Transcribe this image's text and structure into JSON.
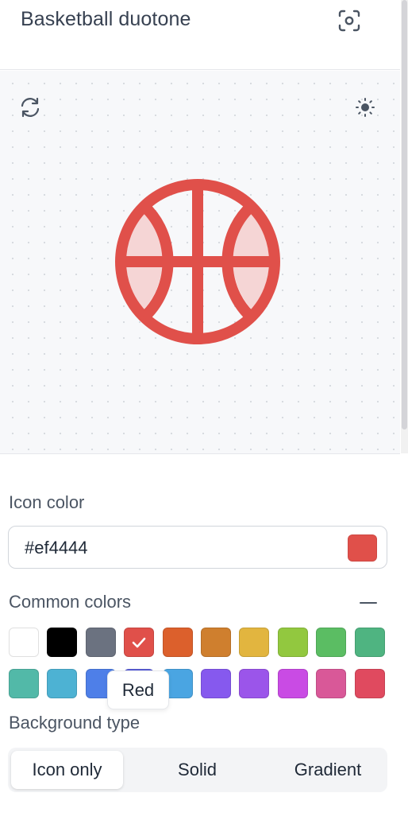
{
  "header": {
    "title": "Basketball duotone",
    "screenshot_icon": "focus-camera-icon"
  },
  "preview": {
    "refresh_icon": "refresh-icon",
    "theme_icon": "sun-icon",
    "icon_name": "basketball-duotone-icon",
    "icon_color": "#e0504a",
    "icon_fill_color": "#f5d5d5"
  },
  "icon_color": {
    "label": "Icon color",
    "value": "#ef4444",
    "swatch": "#e0504a"
  },
  "common_colors": {
    "label": "Common colors",
    "collapse_icon": "minus-icon",
    "selected": "Red",
    "tooltip": "Red",
    "colors": [
      {
        "name": "White",
        "hex": "#ffffff"
      },
      {
        "name": "Black",
        "hex": "#000000"
      },
      {
        "name": "Gray",
        "hex": "#6b7280"
      },
      {
        "name": "Red",
        "hex": "#e0504a"
      },
      {
        "name": "Orange",
        "hex": "#dc602c"
      },
      {
        "name": "Amber",
        "hex": "#cf7f2e"
      },
      {
        "name": "Yellow",
        "hex": "#e2b53f"
      },
      {
        "name": "Lime",
        "hex": "#92c83f"
      },
      {
        "name": "Green",
        "hex": "#5bbd63"
      },
      {
        "name": "Emerald",
        "hex": "#4fb481"
      },
      {
        "name": "Teal",
        "hex": "#52b9a8"
      },
      {
        "name": "Cyan",
        "hex": "#4db2d3"
      },
      {
        "name": "Blue",
        "hex": "#4e7fe8"
      },
      {
        "name": "Indigo",
        "hex": "#5f63e0"
      },
      {
        "name": "Sky",
        "hex": "#4aa5e2"
      },
      {
        "name": "Violet",
        "hex": "#8659ee"
      },
      {
        "name": "Purple",
        "hex": "#9b55ea"
      },
      {
        "name": "Fuchsia",
        "hex": "#c94be4"
      },
      {
        "name": "Pink",
        "hex": "#d95898"
      },
      {
        "name": "Rose",
        "hex": "#e04a5f"
      }
    ]
  },
  "background_type": {
    "label": "Background type",
    "options": [
      "Icon only",
      "Solid",
      "Gradient"
    ],
    "active": "Icon only"
  }
}
